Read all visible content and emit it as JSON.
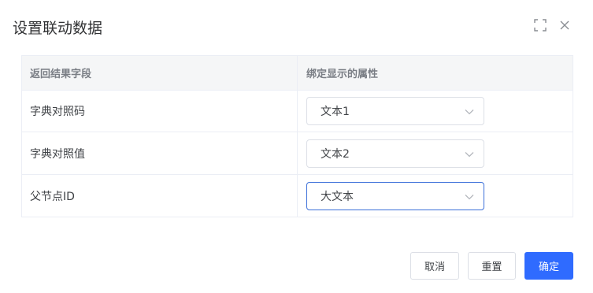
{
  "dialog": {
    "title": "设置联动数据",
    "icons": {
      "fullscreen": "fullscreen-icon",
      "close": "close-icon"
    }
  },
  "table": {
    "headers": [
      "返回结果字段",
      "绑定显示的属性"
    ],
    "rows": [
      {
        "field": "字典对照码",
        "bound": "文本1"
      },
      {
        "field": "字典对照值",
        "bound": "文本2"
      },
      {
        "field": "父节点ID",
        "bound": "大文本"
      }
    ]
  },
  "footer": {
    "cancel_label": "取消",
    "reset_label": "重置",
    "confirm_label": "确定"
  },
  "colors": {
    "primary": "#2f6bff",
    "focused_border": "#3b6fd9",
    "header_bg": "#f5f6f7",
    "border": "#ebeef5"
  }
}
